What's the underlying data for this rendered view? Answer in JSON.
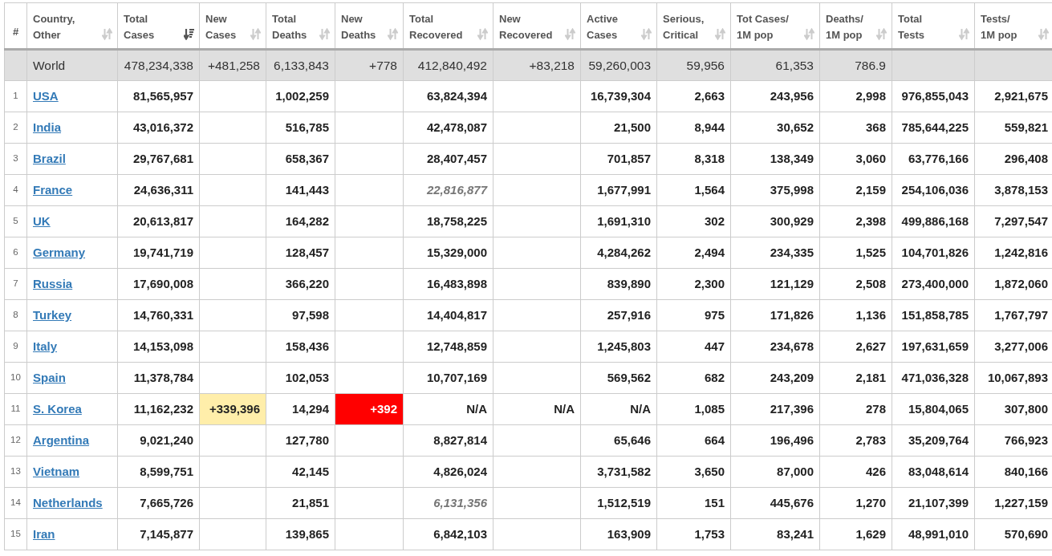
{
  "table": {
    "columns": [
      {
        "label": [
          "#"
        ]
      },
      {
        "label": [
          "Country,",
          "Other"
        ],
        "sort_active": false
      },
      {
        "label": [
          "Total",
          "Cases"
        ],
        "sort_active": true
      },
      {
        "label": [
          "New",
          "Cases"
        ],
        "sort_active": false
      },
      {
        "label": [
          "Total",
          "Deaths"
        ],
        "sort_active": false
      },
      {
        "label": [
          "New",
          "Deaths"
        ],
        "sort_active": false
      },
      {
        "label": [
          "Total",
          "Recovered"
        ],
        "sort_active": false
      },
      {
        "label": [
          "New",
          "Recovered"
        ],
        "sort_active": false
      },
      {
        "label": [
          "Active",
          "Cases"
        ],
        "sort_active": false
      },
      {
        "label": [
          "Serious,",
          "Critical"
        ],
        "sort_active": false
      },
      {
        "label": [
          "Tot Cases/",
          "1M pop"
        ],
        "sort_active": false
      },
      {
        "label": [
          "Deaths/",
          "1M pop"
        ],
        "sort_active": false
      },
      {
        "label": [
          "Total",
          "Tests"
        ],
        "sort_active": false
      },
      {
        "label": [
          "Tests/",
          "1M pop"
        ],
        "sort_active": false
      }
    ],
    "world": {
      "cells": [
        null,
        "World",
        "478,234,338",
        "+481,258",
        "6,133,843",
        "+778",
        "412,840,492",
        "+83,218",
        "59,260,003",
        "59,956",
        "61,353",
        "786.9",
        null,
        null
      ]
    },
    "rows": [
      {
        "cells": [
          "1",
          "USA",
          "81,565,957",
          null,
          "1,002,259",
          null,
          "63,824,394",
          null,
          "16,739,304",
          "2,663",
          "243,956",
          "2,998",
          "976,855,043",
          "2,921,675"
        ]
      },
      {
        "cells": [
          "2",
          "India",
          "43,016,372",
          null,
          "516,785",
          null,
          "42,478,087",
          null,
          "21,500",
          "8,944",
          "30,652",
          "368",
          "785,644,225",
          "559,821"
        ]
      },
      {
        "cells": [
          "3",
          "Brazil",
          "29,767,681",
          null,
          "658,367",
          null,
          "28,407,457",
          null,
          "701,857",
          "8,318",
          "138,349",
          "3,060",
          "63,776,166",
          "296,408"
        ]
      },
      {
        "cells": [
          "4",
          "France",
          "24,636,311",
          null,
          "141,443",
          null,
          {
            "text": "22,816,877",
            "kind": "estimate"
          },
          null,
          "1,677,991",
          "1,564",
          "375,998",
          "2,159",
          "254,106,036",
          "3,878,153"
        ]
      },
      {
        "cells": [
          "5",
          "UK",
          "20,613,817",
          null,
          "164,282",
          null,
          "18,758,225",
          null,
          "1,691,310",
          "302",
          "300,929",
          "2,398",
          "499,886,168",
          "7,297,547"
        ]
      },
      {
        "cells": [
          "6",
          "Germany",
          "19,741,719",
          null,
          "128,457",
          null,
          "15,329,000",
          null,
          "4,284,262",
          "2,494",
          "234,335",
          "1,525",
          "104,701,826",
          "1,242,816"
        ]
      },
      {
        "cells": [
          "7",
          "Russia",
          "17,690,008",
          null,
          "366,220",
          null,
          "16,483,898",
          null,
          "839,890",
          "2,300",
          "121,129",
          "2,508",
          "273,400,000",
          "1,872,060"
        ]
      },
      {
        "cells": [
          "8",
          "Turkey",
          "14,760,331",
          null,
          "97,598",
          null,
          "14,404,817",
          null,
          "257,916",
          "975",
          "171,826",
          "1,136",
          "151,858,785",
          "1,767,797"
        ]
      },
      {
        "cells": [
          "9",
          "Italy",
          "14,153,098",
          null,
          "158,436",
          null,
          "12,748,859",
          null,
          "1,245,803",
          "447",
          "234,678",
          "2,627",
          "197,631,659",
          "3,277,006"
        ]
      },
      {
        "cells": [
          "10",
          "Spain",
          "11,378,784",
          null,
          "102,053",
          null,
          "10,707,169",
          null,
          "569,562",
          "682",
          "243,209",
          "2,181",
          "471,036,328",
          "10,067,893"
        ]
      },
      {
        "cells": [
          "11",
          "S. Korea",
          "11,162,232",
          {
            "text": "+339,396",
            "kind": "warning"
          },
          "14,294",
          {
            "text": "+392",
            "kind": "danger"
          },
          "N/A",
          "N/A",
          "N/A",
          "1,085",
          "217,396",
          "278",
          "15,804,065",
          "307,800"
        ]
      },
      {
        "cells": [
          "12",
          "Argentina",
          "9,021,240",
          null,
          "127,780",
          null,
          "8,827,814",
          null,
          "65,646",
          "664",
          "196,496",
          "2,783",
          "35,209,764",
          "766,923"
        ]
      },
      {
        "cells": [
          "13",
          "Vietnam",
          "8,599,751",
          null,
          "42,145",
          null,
          "4,826,024",
          null,
          "3,731,582",
          "3,650",
          "87,000",
          "426",
          "83,048,614",
          "840,166"
        ]
      },
      {
        "cells": [
          "14",
          "Netherlands",
          "7,665,726",
          null,
          "21,851",
          null,
          {
            "text": "6,131,356",
            "kind": "estimate"
          },
          null,
          "1,512,519",
          "151",
          "445,676",
          "1,270",
          "21,107,399",
          "1,227,159"
        ]
      },
      {
        "cells": [
          "15",
          "Iran",
          "7,145,877",
          null,
          "139,865",
          null,
          "6,842,103",
          null,
          "163,909",
          "1,753",
          "83,241",
          "1,629",
          "48,991,010",
          "570,690"
        ]
      }
    ]
  }
}
